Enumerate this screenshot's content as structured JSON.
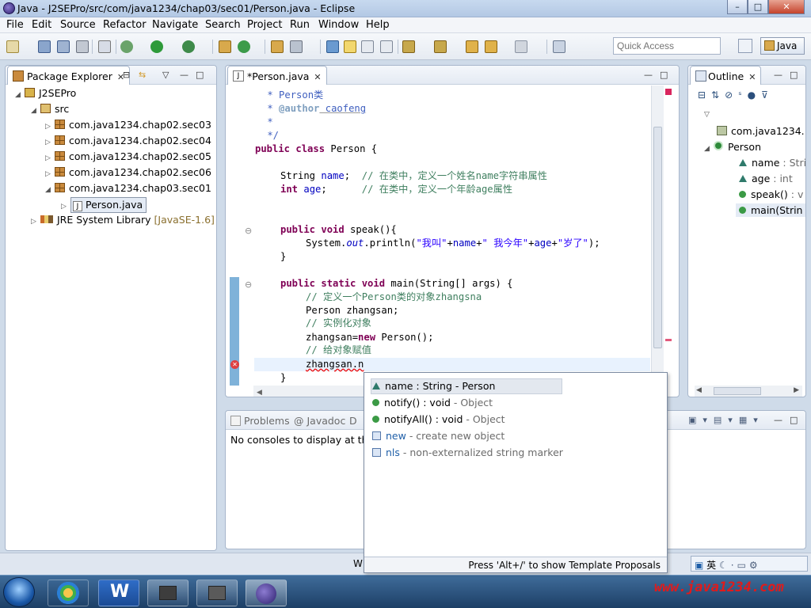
{
  "window": {
    "title": "Java - J2SEPro/src/com/java1234/chap03/sec01/Person.java - Eclipse",
    "controls": [
      "–",
      "□",
      "✕"
    ]
  },
  "menu": [
    "File",
    "Edit",
    "Source",
    "Refactor",
    "Navigate",
    "Search",
    "Project",
    "Run",
    "Window",
    "Help"
  ],
  "toolbar": {
    "quick_access_placeholder": "Quick Access",
    "perspective": "Java"
  },
  "package_explorer": {
    "tab_label": "Package Explorer",
    "project": "J2SEPro",
    "src": "src",
    "packages": [
      "com.java1234.chap02.sec03",
      "com.java1234.chap02.sec04",
      "com.java1234.chap02.sec05",
      "com.java1234.chap02.sec06",
      "com.java1234.chap03.sec01"
    ],
    "file": "Person.java",
    "jre_label": "JRE System Library",
    "jre_version": "[JavaSE-1.6]"
  },
  "editor": {
    "tab_label": "*Person.java",
    "code": {
      "l1_a": " * ",
      "l1_b": "Person类",
      "l2_a": " * ",
      "l2_b": "@author",
      "l2_c": " caofeng",
      "l3": " *",
      "l4": " */",
      "l5_kw": "public class",
      "l5_rest": " Person {",
      "l6_type": "String",
      "l6_field": "name",
      "l6_semi": ";  ",
      "l6_cm": "// 在类中，定义一个姓名name字符串属性",
      "l7_kw": "int",
      "l7_field": "age",
      "l7_semi": ";      ",
      "l7_cm": "// 在类中，定义一个年龄age属性",
      "l8_kw": "public void",
      "l8_rest": " speak(){",
      "l9_a": "System.",
      "l9_out": "out",
      "l9_b": ".println(",
      "l9_s1": "\"我叫\"",
      "l9_c": "+",
      "l9_f1": "name",
      "l9_d": "+",
      "l9_s2": "\" 我今年\"",
      "l9_e": "+",
      "l9_f2": "age",
      "l9_f": "+",
      "l9_s3": "\"岁了\"",
      "l9_g": ");",
      "l10": "}",
      "l11_kw": "public static void",
      "l11_rest": " main(String[] args) {",
      "l12": "// 定义一个Person类的对象zhangsna",
      "l13": "Person zhangsan;",
      "l14": "// 实例化对象",
      "l15_a": "zhangsan=",
      "l15_kw": "new",
      "l15_b": " Person();",
      "l16": "// 给对象赋值",
      "l17": "zhangsan.n",
      "l18": "}"
    }
  },
  "outline": {
    "tab_label": "Outline",
    "items": [
      {
        "name": "com.java1234."
      },
      {
        "name": "Person"
      },
      {
        "name": "name",
        "detail": " : Stri"
      },
      {
        "name": "age",
        "detail": " : int"
      },
      {
        "name": "speak()",
        "detail": " : v"
      },
      {
        "name": "main(Strin"
      }
    ]
  },
  "bottom_panel": {
    "tabs": [
      "Problems",
      "@ Javadoc",
      "D"
    ],
    "message": "No consoles to display at thi"
  },
  "content_assist": {
    "items": [
      {
        "name": "name : String",
        "owner": " - Person"
      },
      {
        "name": "notify() : void",
        "owner": " - Object"
      },
      {
        "name": "notifyAll() : void",
        "owner": " - Object"
      },
      {
        "name": "new",
        "owner": " - create new object"
      },
      {
        "name": "nls",
        "owner": " - non-externalized string marker"
      }
    ],
    "footer": "Press 'Alt+/' to show Template Proposals"
  },
  "status": {
    "ime": "英"
  },
  "watermark": "www.java1234.com"
}
